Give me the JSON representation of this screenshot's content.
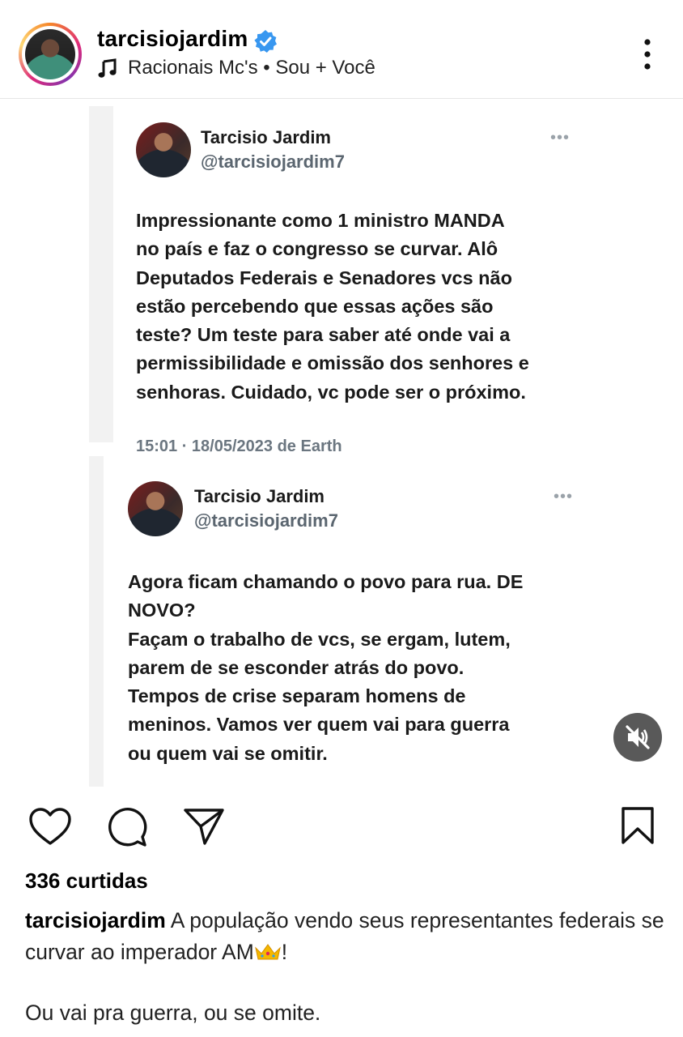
{
  "post_header": {
    "username": "tarcisiojardim",
    "audio": "Racionais Mc's • Sou + Você"
  },
  "tweets": [
    {
      "name": "Tarcisio Jardim",
      "handle": "@tarcisiojardim7",
      "more": "•••",
      "text": "Impressionante como 1 ministro MANDA\nno país e faz o congresso se curvar. Alô\nDeputados Federais e Senadores vcs não\nestão percebendo que essas ações são\nteste? Um teste para saber até onde vai a\npermissibilidade e omissão dos senhores e\nsenhoras. Cuidado, vc pode ser o próximo.",
      "timestamp": "15:01 · 18/05/2023 de Earth"
    },
    {
      "name": "Tarcisio Jardim",
      "handle": "@tarcisiojardim7",
      "more": "•••",
      "text": "Agora ficam chamando o povo para rua. DE\nNOVO?\nFaçam o trabalho de vcs, se ergam, lutem,\nparem de se esconder atrás do povo.\nTempos de crise separam homens de\nmeninos. Vamos ver quem vai para guerra\nou quem vai se omitir."
    }
  ],
  "engagement": {
    "likes": "336 curtidas"
  },
  "caption": {
    "username": "tarcisiojardim",
    "text_before": "A população vendo seus representantes federais se curvar ao imperador AM",
    "text_after": "!",
    "line2": "Ou vai pra guerra, ou se omite."
  },
  "icons": {
    "verified": "verified-badge-icon",
    "music": "music-note-icon",
    "more": "more-options-icon",
    "mute": "muted-speaker-icon",
    "like": "heart-icon",
    "comment": "comment-bubble-icon",
    "share": "paper-plane-icon",
    "save": "bookmark-icon",
    "crown": "crown-emoji"
  },
  "colors": {
    "verified_blue": "#3897f0",
    "handle_gray": "#5b6670",
    "ring_gradient": [
      "#f58529",
      "#dd2a7b",
      "#8134af",
      "#feda77"
    ]
  }
}
